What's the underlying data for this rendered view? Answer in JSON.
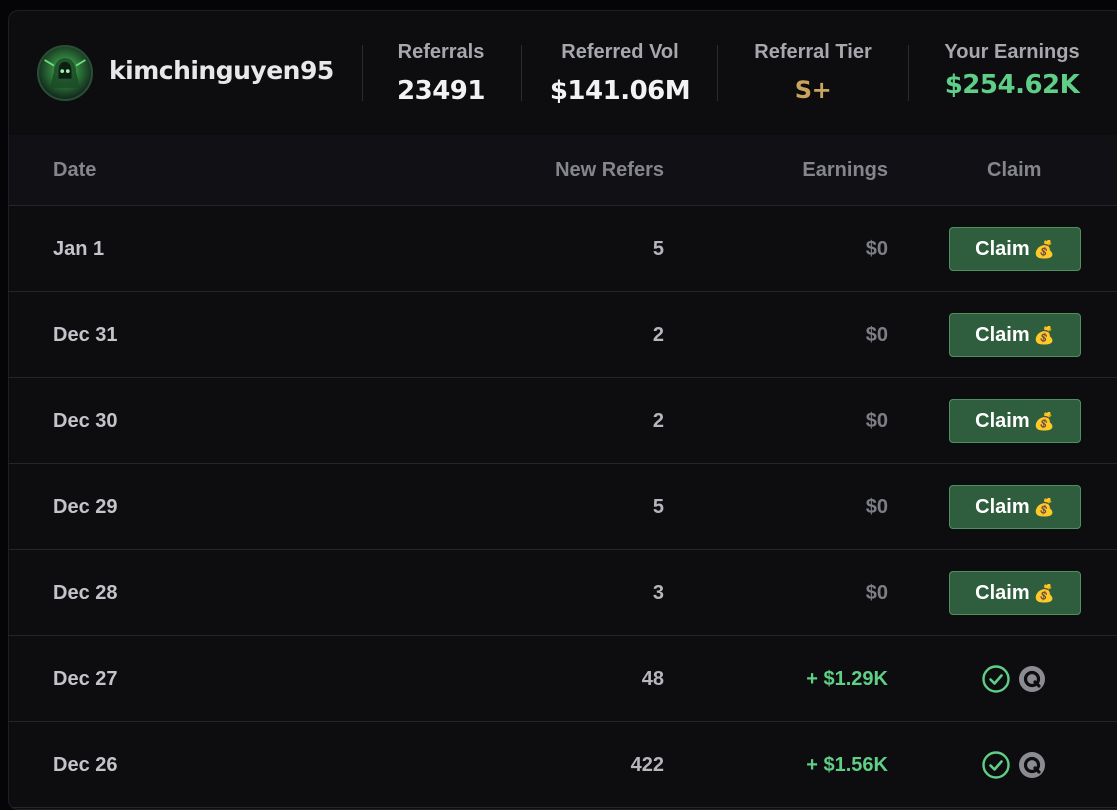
{
  "profile": {
    "username": "kimchinguyen95",
    "avatar_icon": "green-hooded-figure-avatar"
  },
  "stats": [
    {
      "label": "Referrals",
      "value": "23491"
    },
    {
      "label": "Referred Vol",
      "value": "$141.06M"
    },
    {
      "label": "Referral Tier",
      "value": "S+"
    },
    {
      "label": "Your Earnings",
      "value": "$254.62K"
    }
  ],
  "table": {
    "columns": [
      "Date",
      "New Refers",
      "Earnings",
      "Claim"
    ],
    "claim_label": "Claim",
    "claim_icon": "money-bag-icon",
    "claimed_icons": [
      "check-circle-icon",
      "token-logo-icon"
    ],
    "rows": [
      {
        "date": "Jan 1",
        "new_refers": "5",
        "earnings": "$0",
        "status": "claimable"
      },
      {
        "date": "Dec 31",
        "new_refers": "2",
        "earnings": "$0",
        "status": "claimable"
      },
      {
        "date": "Dec 30",
        "new_refers": "2",
        "earnings": "$0",
        "status": "claimable"
      },
      {
        "date": "Dec 29",
        "new_refers": "5",
        "earnings": "$0",
        "status": "claimable"
      },
      {
        "date": "Dec 28",
        "new_refers": "3",
        "earnings": "$0",
        "status": "claimable"
      },
      {
        "date": "Dec 27",
        "new_refers": "48",
        "earnings": "+ $1.29K",
        "status": "claimed"
      },
      {
        "date": "Dec 26",
        "new_refers": "422",
        "earnings": "+ $1.56K",
        "status": "claimed"
      }
    ]
  },
  "colors": {
    "background": "#0d0d10",
    "positive": "#5fce86",
    "tier": "#c9a45c",
    "claim_button": "#2e5e3d"
  }
}
